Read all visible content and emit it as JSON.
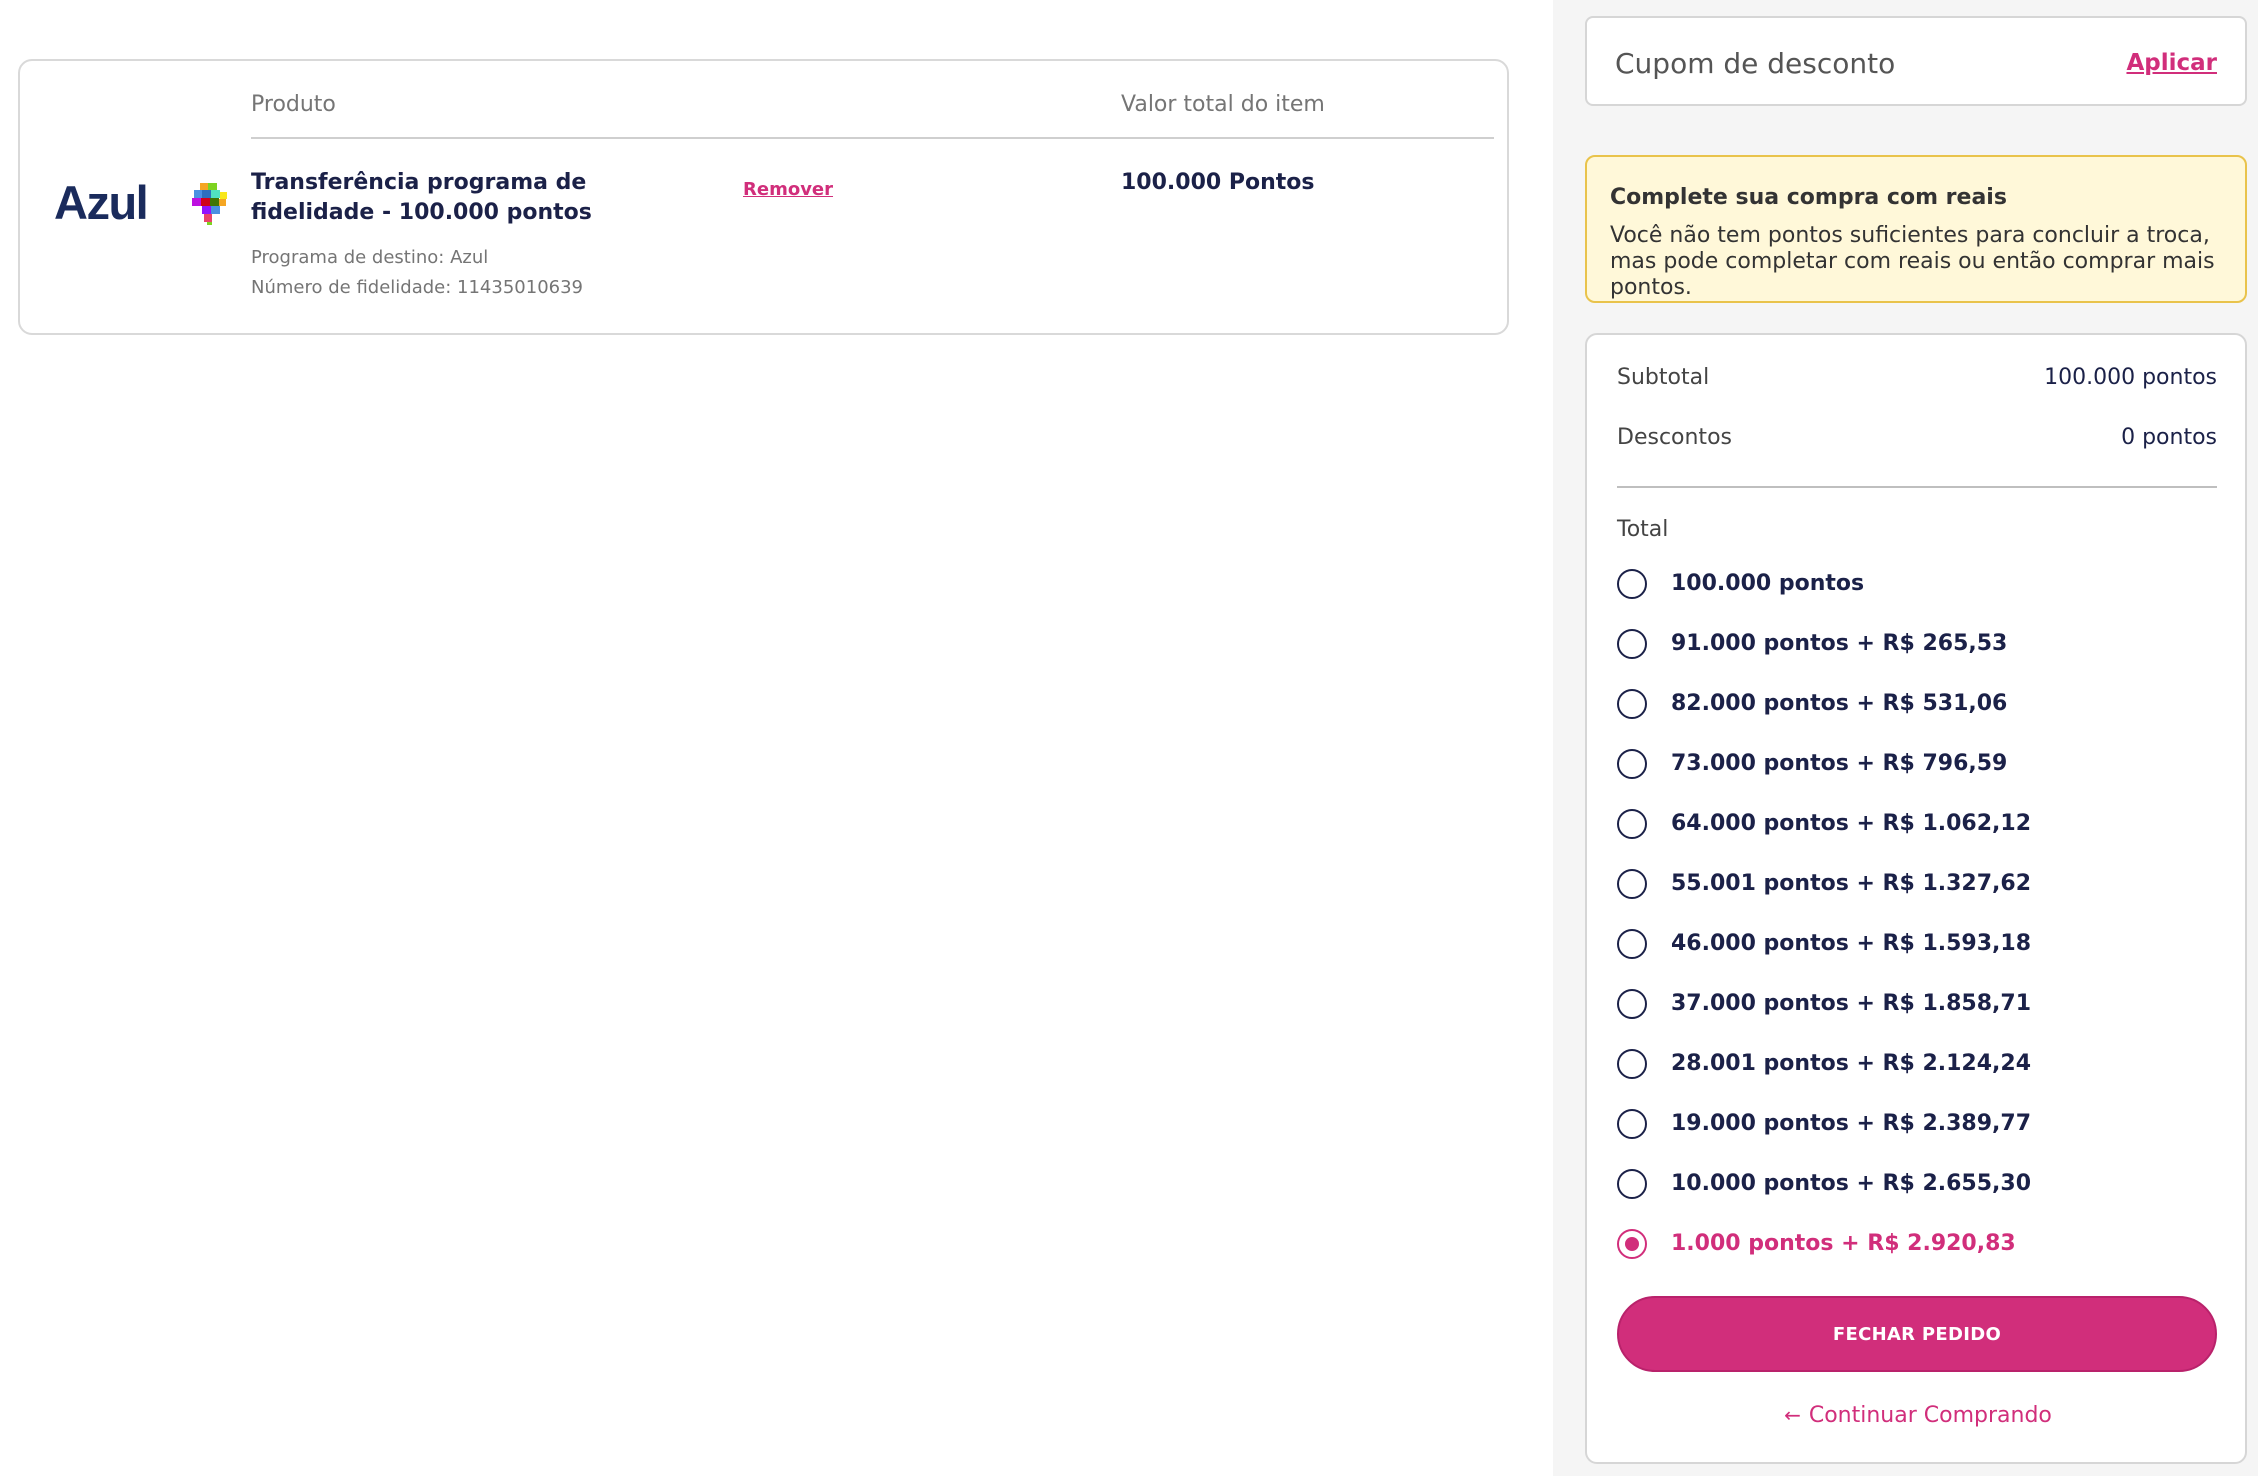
{
  "cart": {
    "column_product": "Produto",
    "column_value": "Valor total do item",
    "item": {
      "logo_text": "Azul",
      "title": "Transferência programa de fidelidade - 100.000 pontos",
      "remove_label": "Remover",
      "value": "100.000 Pontos",
      "destination": "Programa de destino: Azul",
      "loyalty_number": "Número de fidelidade: 11435010639"
    }
  },
  "coupon": {
    "label": "Cupom de desconto",
    "apply_label": "Aplicar"
  },
  "alert": {
    "title": "Complete sua compra com reais",
    "text": "Você não tem pontos suficientes para concluir a troca, mas pode completar com reais ou então comprar mais pontos."
  },
  "summary": {
    "subtotal_label": "Subtotal",
    "subtotal_value": "100.000 pontos",
    "discounts_label": "Descontos",
    "discounts_value": "0 pontos",
    "total_label": "Total",
    "options": [
      "100.000 pontos",
      "91.000 pontos + R$ 265,53",
      "82.000 pontos + R$ 531,06",
      "73.000 pontos + R$ 796,59",
      "64.000 pontos + R$ 1.062,12",
      "55.001 pontos + R$ 1.327,62",
      "46.000 pontos + R$ 1.593,18",
      "37.000 pontos + R$ 1.858,71",
      "28.001 pontos + R$ 2.124,24",
      "19.000 pontos + R$ 2.389,77",
      "10.000 pontos + R$ 2.655,30",
      "1.000 pontos + R$ 2.920,83"
    ],
    "selected_index": 11,
    "close_order_label": "FECHAR PEDIDO",
    "continue_label": "Continuar Comprando"
  },
  "colors": {
    "accent": "#d12e7b",
    "text_dark": "#1b2148",
    "alert_bg": "#fff8d9",
    "alert_border": "#e9c34b"
  },
  "icons": {
    "logo_mark": "brazil-map-icon",
    "continue": "arrow-left-icon"
  }
}
